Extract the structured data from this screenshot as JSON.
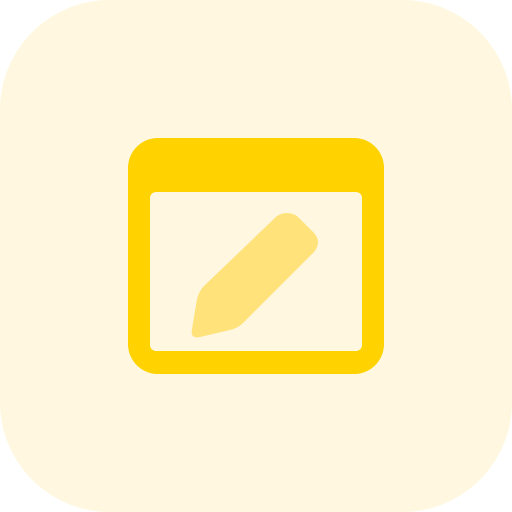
{
  "app_icon": {
    "name": "browser-edit",
    "icon": "browser-window-pencil-icon",
    "colors": {
      "tile_background": "#fff7df",
      "window_frame": "#ffd200",
      "window_content": "#fff7df",
      "pencil": "#ffe27a"
    }
  }
}
